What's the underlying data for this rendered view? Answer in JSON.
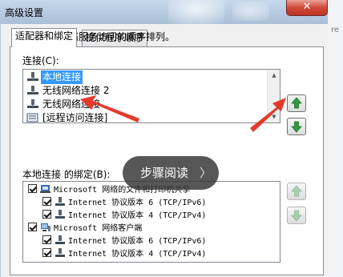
{
  "window": {
    "title": "高级设置",
    "close_label": "✕"
  },
  "tabs": [
    {
      "label": "适配器和绑定",
      "active": true
    },
    {
      "label": "提供程序顺序",
      "active": false
    }
  ],
  "description": "连接按绑网络服务访问的顺序排列。",
  "connections": {
    "label": "连接(C):",
    "items": [
      {
        "label": "本地连接",
        "selected": true
      },
      {
        "label": "无线网络连接 2",
        "selected": false
      },
      {
        "label": "无线网络连接",
        "selected": false
      },
      {
        "label": "[远程访问连接]",
        "selected": false
      }
    ]
  },
  "bindings": {
    "label": "本地连接 的绑定(B):",
    "items": [
      {
        "label": "Microsoft 网络的文件和打印机共享",
        "level": 0,
        "checked": true,
        "icon": "file-printer-sharing-icon"
      },
      {
        "label": "Internet 协议版本 6 (TCP/IPv6)",
        "level": 1,
        "checked": true,
        "icon": "protocol-icon"
      },
      {
        "label": "Internet 协议版本 4 (TCP/IPv4)",
        "level": 1,
        "checked": true,
        "icon": "protocol-icon"
      },
      {
        "label": "Microsoft 网络客户端",
        "level": 0,
        "checked": true,
        "icon": "network-client-icon"
      },
      {
        "label": "Internet 协议版本 6 (TCP/IPv6)",
        "level": 1,
        "checked": true,
        "icon": "protocol-icon"
      },
      {
        "label": "Internet 协议版本 4 (TCP/IPv4)",
        "level": 1,
        "checked": true,
        "icon": "protocol-icon"
      }
    ]
  },
  "overlay": {
    "label": "步骤阅读",
    "chevron": "〉"
  },
  "colors": {
    "selection": "#3399ff",
    "arrow_green": "#2e9b3a",
    "annotation_red": "#e23b2e"
  },
  "right_fragment": "re"
}
